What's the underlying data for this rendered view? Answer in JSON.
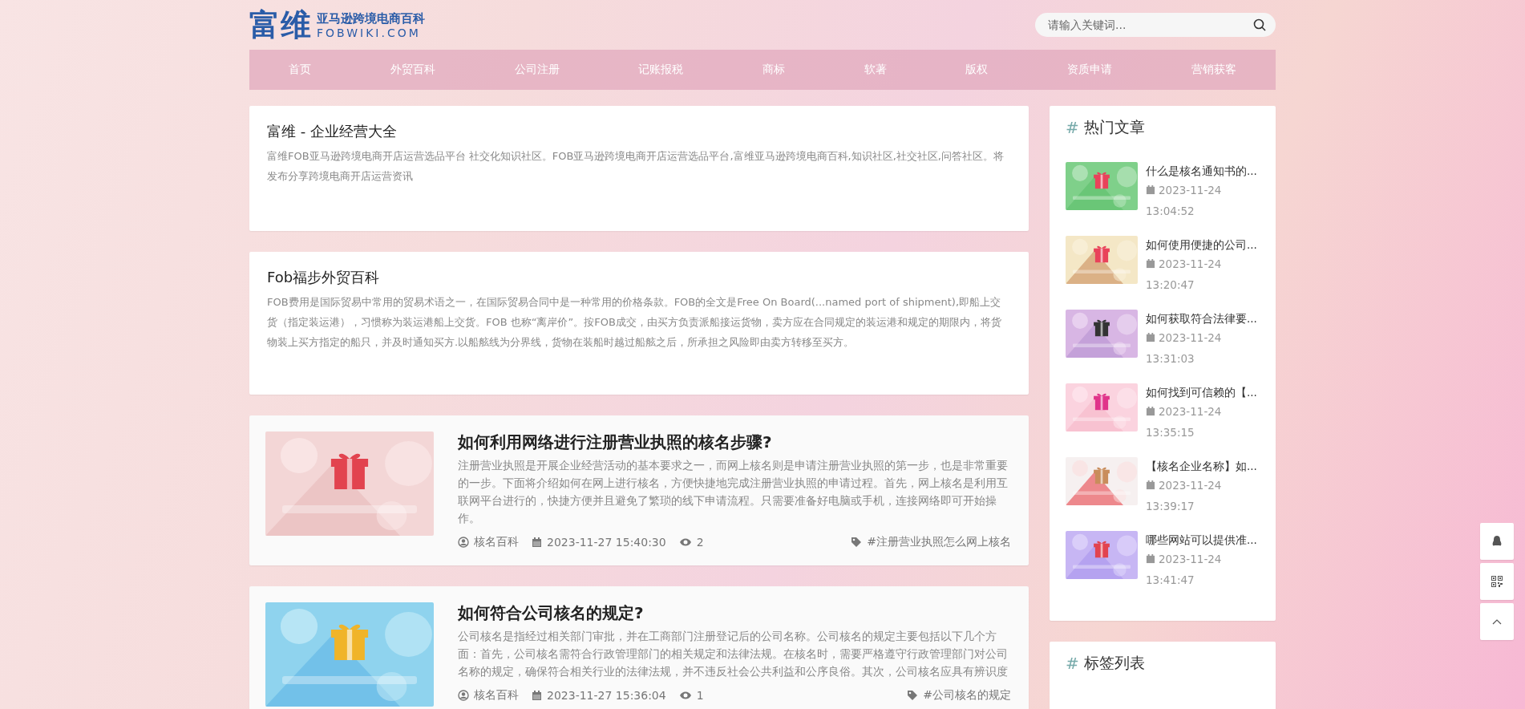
{
  "logo": {
    "title": "富维",
    "subtitle": "亚马逊跨境电商百科",
    "domain": "FOBWIKI.COM"
  },
  "search": {
    "placeholder": "请输入关键词..."
  },
  "nav": [
    "首页",
    "外贸百科",
    "公司注册",
    "记账报税",
    "商标",
    "软著",
    "版权",
    "资质申请",
    "营销获客"
  ],
  "intro_cards": [
    {
      "title": "富维 - 企业经营大全",
      "text": "富维FOB亚马逊跨境电商开店运营选品平台 社交化知识社区。FOB亚马逊跨境电商开店运营选品平台,富维亚马逊跨境电商百科,知识社区,社交社区,问答社区。将发布分享跨境电商开店运营资讯"
    },
    {
      "title": "Fob福步外贸百科",
      "text": "FOB费用是国际贸易中常用的贸易术语之一，在国际贸易合同中是一种常用的价格条款。FOB的全文是Free On Board(...named port of shipment),即船上交货（指定装运港），习惯称为装运港船上交货。FOB 也称“离岸价”。按FOB成交，由买方负责派船接运货物，卖方应在合同规定的装运港和规定的期限内，将货物装上买方指定的船只，并及时通知买方.以船舷线为分界线，货物在装船时越过船舷之后，所承担之风险即由卖方转移至买方。"
    }
  ],
  "articles": [
    {
      "title": "如何利用网络进行注册营业执照的核名步骤?",
      "excerpt": "注册营业执照是开展企业经营活动的基本要求之一，而网上核名则是申请注册营业执照的第一步，也是非常重要的一步。下面将介绍如何在网上进行核名，方便快捷地完成注册营业执照的申请过程。首先，网上核名是利用互联网平台进行的，快捷方便并且避免了繁琐的线下申请流程。只需要准备好电脑或手机，连接网络即可开始操作。",
      "author": "核名百科",
      "date": "2023-11-27 15:40:30",
      "views": "2",
      "tag": "#注册营业执照怎么网上核名"
    },
    {
      "title": "如何符合公司核名的规定?",
      "excerpt": "公司核名是指经过相关部门审批，并在工商部门注册登记后的公司名称。公司核名的规定主要包括以下几个方面：首先，公司核名需符合行政管理部门的相关规定和法律法规。在核名时，需要严格遵守行政管理部门对公司名称的规定，确保符合相关行业的法律法规，并不违反社会公共利益和公序良俗。其次，公司核名应具有辨识度",
      "author": "核名百科",
      "date": "2023-11-27 15:36:04",
      "views": "1",
      "tag": "#公司核名的规定"
    }
  ],
  "hot": {
    "hash": "#",
    "title": "热门文章",
    "items": [
      {
        "title": "什么是核名通知书的...",
        "date": "2023-11-24",
        "time": "13:04:52"
      },
      {
        "title": "如何使用便捷的公司...",
        "date": "2023-11-24",
        "time": "13:20:47"
      },
      {
        "title": "如何获取符合法律要...",
        "date": "2023-11-24",
        "time": "13:31:03"
      },
      {
        "title": "如何找到可信赖的【...",
        "date": "2023-11-24",
        "time": "13:35:15"
      },
      {
        "title": "【核名企业名称】如...",
        "date": "2023-11-24",
        "time": "13:39:17"
      },
      {
        "title": "哪些网站可以提供准...",
        "date": "2023-11-24",
        "time": "13:41:47"
      }
    ]
  },
  "tags": {
    "hash": "#",
    "title": "标签列表"
  }
}
